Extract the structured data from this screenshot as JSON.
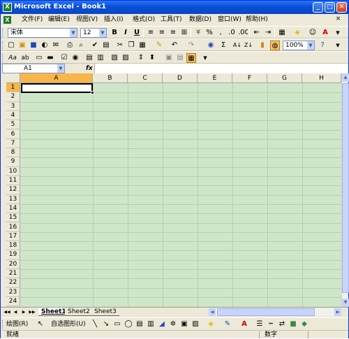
{
  "window": {
    "title": "Microsoft Excel - Book1",
    "app_icon_letter": "X"
  },
  "title_buttons": {
    "minimize": "_",
    "maximize": "□",
    "close": "✕"
  },
  "menubar": {
    "items": [
      {
        "label": "文件(F)"
      },
      {
        "label": "编辑(E)"
      },
      {
        "label": "视图(V)"
      },
      {
        "label": "插入(I)"
      },
      {
        "label": "格式(O)"
      },
      {
        "label": "工具(T)"
      },
      {
        "label": "数据(D)"
      },
      {
        "label": "窗口(W)"
      },
      {
        "label": "帮助(H)"
      }
    ],
    "close_label": "×"
  },
  "format_toolbar": {
    "font_name": "宋体",
    "font_size": "12",
    "bold": "B",
    "italic": "I",
    "underline": "U",
    "icons": [
      "align-left-icon",
      "align-center-icon",
      "align-right-icon",
      "merge-center-icon",
      "currency-icon",
      "percent-icon",
      "comma-icon",
      "increase-decimal-icon",
      "decrease-decimal-icon",
      "decrease-indent-icon",
      "increase-indent-icon",
      "borders-icon",
      "fill-color-icon",
      "font-color-icon"
    ],
    "percent": "%",
    "comma": ","
  },
  "standard_toolbar": {
    "zoom": "100%",
    "sum_symbol": "Σ",
    "sort_asc": "A↓",
    "sort_desc": "Z↓",
    "help": "?"
  },
  "forms_toolbar": {
    "label_aa": "Aa",
    "label_ab": "ab"
  },
  "formula_bar": {
    "name_box": "A1",
    "fx": "fx"
  },
  "grid": {
    "columns": [
      "A",
      "B",
      "C",
      "D",
      "E",
      "F",
      "G",
      "H"
    ],
    "rows": [
      "1",
      "2",
      "3",
      "4",
      "5",
      "6",
      "7",
      "8",
      "9",
      "10",
      "11",
      "12",
      "13",
      "14",
      "15",
      "16",
      "17",
      "18",
      "19",
      "20",
      "21",
      "22",
      "23",
      "24"
    ],
    "active_cell": "A1"
  },
  "sheets": {
    "tabs": [
      {
        "label": "Sheet1"
      },
      {
        "label": "Sheet2"
      },
      {
        "label": "Sheet3"
      }
    ],
    "active": "Sheet1"
  },
  "drawing_toolbar": {
    "draw_label": "绘图(R)",
    "autoshapes_label": "自选图形(U)"
  },
  "status_bar": {
    "ready": "就绪",
    "mode": "数字"
  },
  "colors": {
    "grid_bg": "#cfe6c9",
    "selection_header": "#f8b54a",
    "titlebar": "#0a4fd8"
  }
}
